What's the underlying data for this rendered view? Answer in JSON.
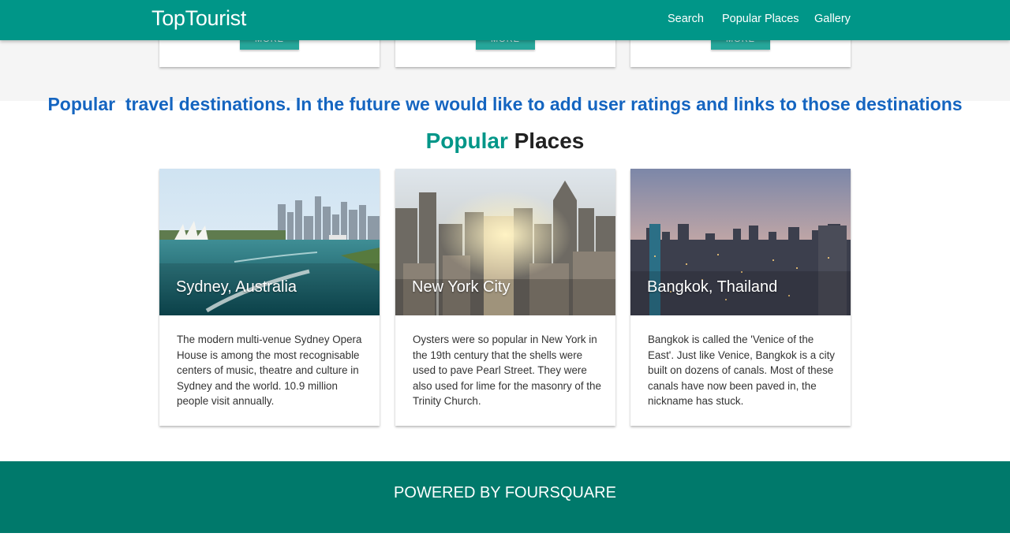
{
  "navbar": {
    "brand": "TopTourist",
    "links": [
      "Search",
      "Popular Places",
      "Gallery"
    ]
  },
  "previous_section": {
    "button_label": "MORE"
  },
  "banner": {
    "text": "Popular  travel destinations. In the future we would like to add user ratings and links to those destinations"
  },
  "section": {
    "title_accent": "Popular",
    "title_rest": " Places"
  },
  "cards": [
    {
      "title": "Sydney, Australia",
      "description": "The modern multi-venue Sydney Opera House is among the most recognisable centers of music, theatre and culture in Sydney and the world. 10.9 million people visit annually."
    },
    {
      "title": "New York City",
      "description": "Oysters were so popular in New York in the 19th century that the shells were used to pave Pearl Street. They were also used for lime for the masonry of the Trinity Church."
    },
    {
      "title": "Bangkok, Thailand",
      "description": "Bangkok is called the 'Venice of the East'. Just like Venice, Bangkok is a city built on dozens of canals. Most of these canals have now been paved in, the nickname has stuck."
    }
  ],
  "footer": {
    "text": "POWERED BY FOURSQUARE"
  },
  "colors": {
    "primary": "#009688",
    "footer": "#00796b",
    "banner_text": "#1565c0",
    "accent_button": "#26a69a"
  }
}
